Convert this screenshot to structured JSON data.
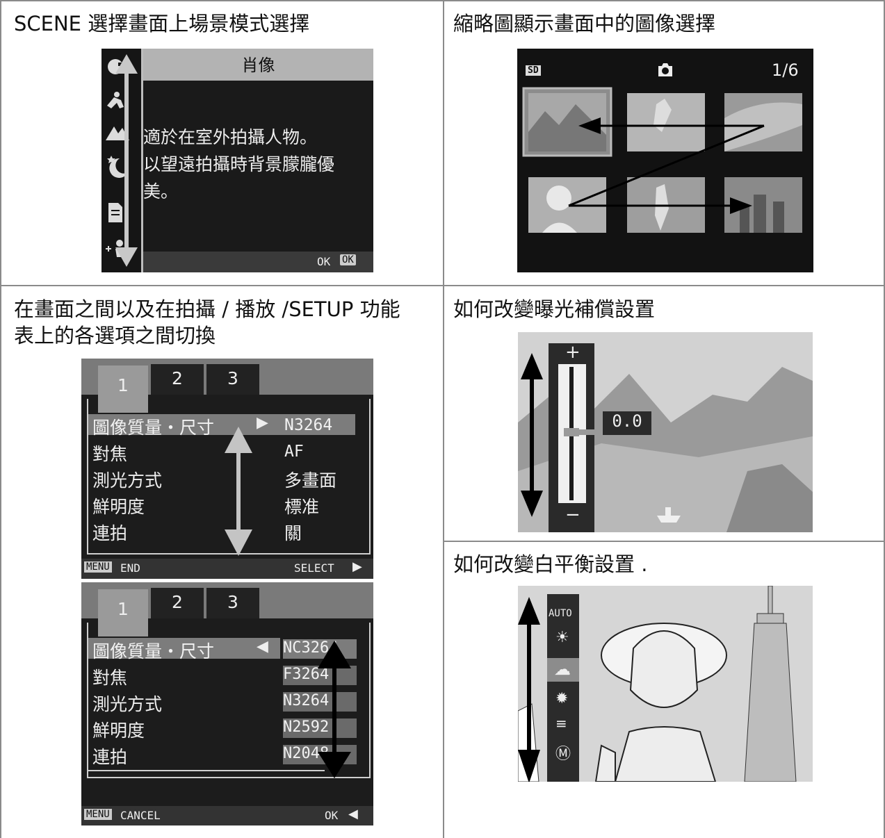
{
  "cells": {
    "scene": {
      "title": "SCENE 選擇畫面上場景模式選擇"
    },
    "thumb": {
      "title": "縮略圖顯示畫面中的圖像選擇"
    },
    "menu": {
      "title_line1": "在畫面之間以及在拍攝 / 播放 /SETUP 功能",
      "title_line2": "表上的各選項之間切換"
    },
    "exposure": {
      "title": "如何改變曝光補償設置"
    },
    "wb": {
      "title": "如何改變白平衡設置 ."
    }
  },
  "scene_screen": {
    "header": "肖像",
    "desc_line1": "適於在室外拍攝人物。",
    "desc_line2": "以望遠拍攝時背景朦朧優",
    "desc_line3": "美。",
    "ok_label": "OK",
    "ok_key": "OK",
    "icons": [
      "portrait-icon",
      "sports-icon",
      "landscape-icon",
      "night-icon",
      "text-icon",
      "hi-sensitivity-icon"
    ]
  },
  "thumb_screen": {
    "card_label": "SD",
    "counter": "1/6",
    "mode_icon": "camera-icon"
  },
  "menu_screen1": {
    "tabs": [
      "1",
      "2",
      "3"
    ],
    "rows": [
      {
        "label": "圖像質量・尺寸",
        "value": "N3264"
      },
      {
        "label": "對焦",
        "value": "AF"
      },
      {
        "label": "測光方式",
        "value": "多畫面"
      },
      {
        "label": "鮮明度",
        "value": "標准"
      },
      {
        "label": "連拍",
        "value": "關"
      }
    ],
    "footer_key": "MENU",
    "footer_left": "END",
    "footer_right": "SELECT"
  },
  "menu_screen2": {
    "tabs": [
      "1",
      "2",
      "3"
    ],
    "rows": [
      {
        "label": "圖像質量・尺寸",
        "value": "NC3264"
      },
      {
        "label": "對焦",
        "value": "F3264"
      },
      {
        "label": "測光方式",
        "value": "N3264"
      },
      {
        "label": "鮮明度",
        "value": "N2592"
      },
      {
        "label": "連拍",
        "value": "N2048"
      }
    ],
    "footer_key": "MENU",
    "footer_left": "CANCEL",
    "footer_right": "OK"
  },
  "exposure_screen": {
    "plus": "+",
    "minus": "−",
    "value": "0.0"
  },
  "wb_screen": {
    "auto_label": "AUTO",
    "icons": [
      "sun-icon",
      "cloud-icon",
      "tungsten-icon",
      "fluorescent-icon",
      "manual-icon"
    ]
  }
}
